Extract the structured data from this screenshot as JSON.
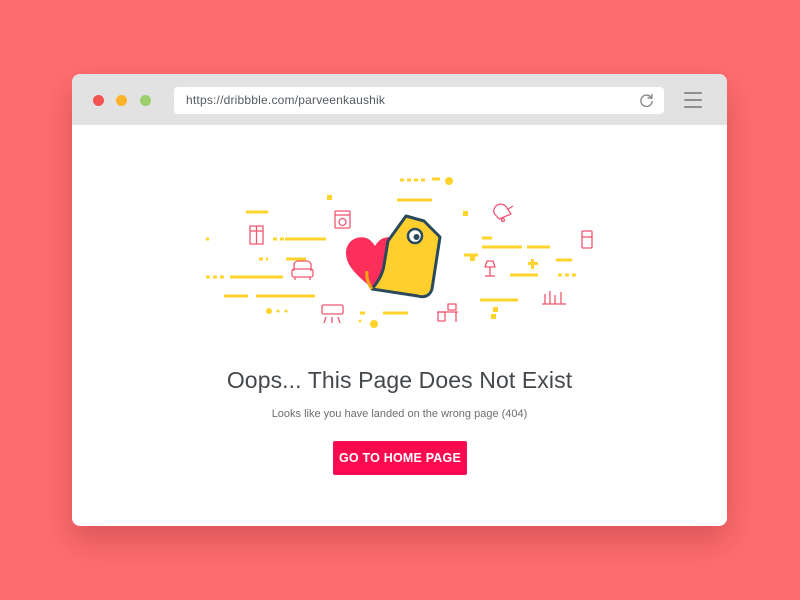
{
  "browser": {
    "url": "https://dribbble.com/parveenkaushik",
    "traffic_lights": [
      "#f2534f",
      "#fbb32a",
      "#9ccf6b"
    ]
  },
  "error_page": {
    "title": "Oops... This Page Does Not Exist",
    "subtitle": "Looks like you have landed on the wrong page (404)",
    "cta_label": "GO TO HOME PAGE"
  },
  "colors": {
    "background": "#fe6d6f",
    "accent": "#fc0a4f",
    "tag_yellow": "#ffcf2e",
    "heart": "#fc2e5a",
    "outline": "#2a4a5c",
    "dash_yellow": "#fed32b",
    "icon_pink": "#f25670"
  },
  "icons": [
    "washing-machine-icon",
    "wardrobe-icon",
    "armchair-icon",
    "air-conditioner-icon",
    "desk-icon",
    "lamp-icon",
    "bell-icon",
    "fridge-icon",
    "shelf-icon",
    "heart-icon",
    "price-tag-icon"
  ]
}
